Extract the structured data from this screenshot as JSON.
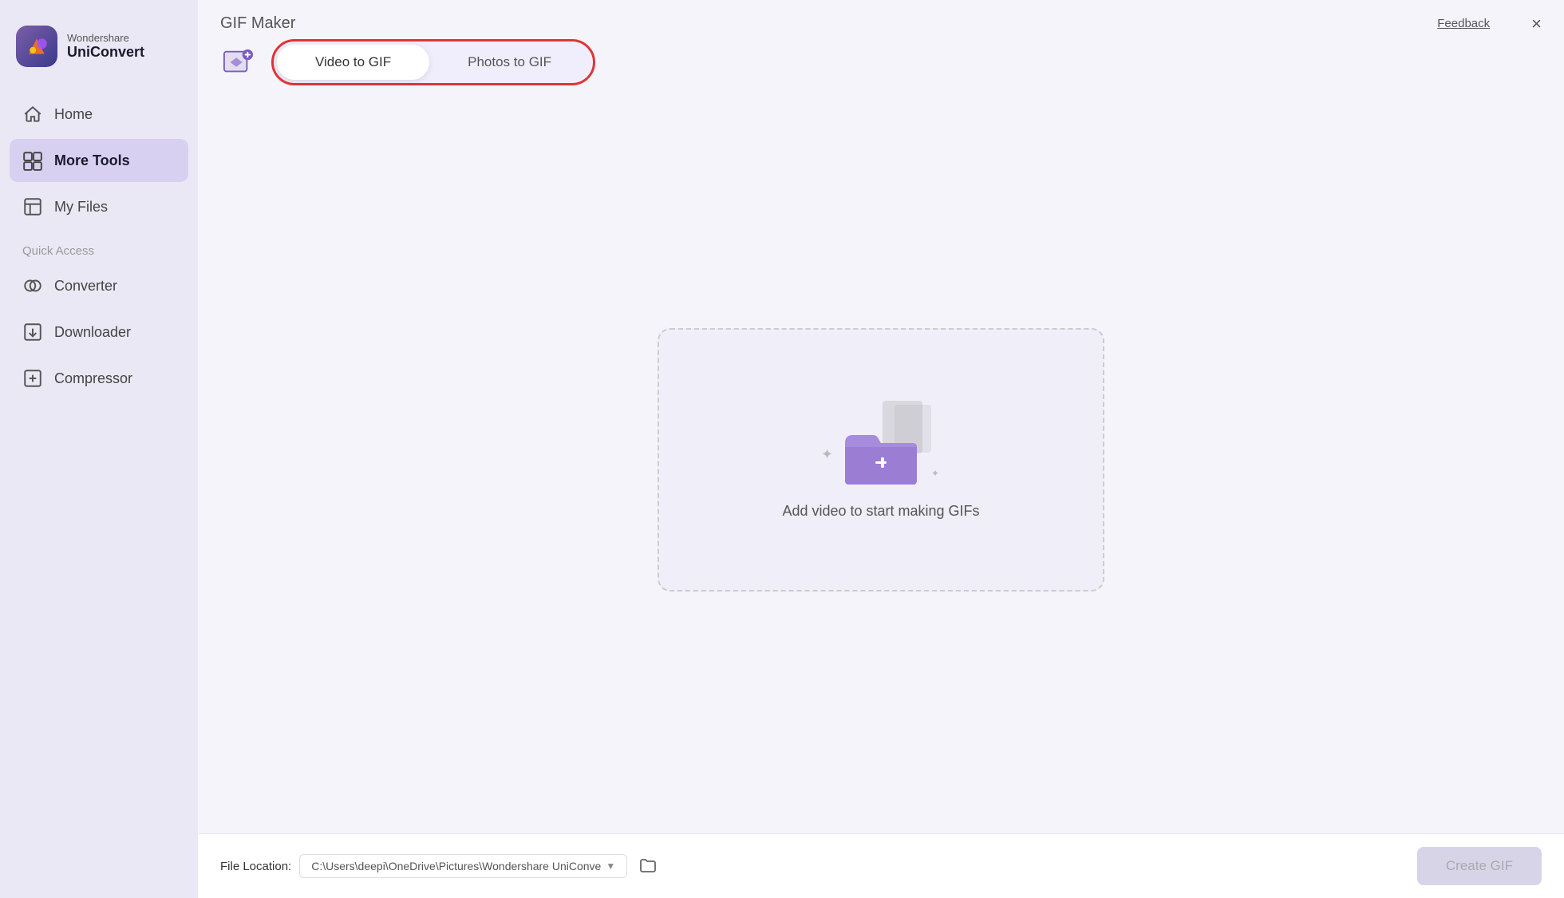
{
  "app": {
    "name": "Wondershare",
    "product": "UniConvert",
    "feedback_label": "Feedback",
    "close_label": "×"
  },
  "sidebar": {
    "nav_items": [
      {
        "id": "home",
        "label": "Home",
        "icon": "home-icon",
        "active": false
      },
      {
        "id": "more-tools",
        "label": "More Tools",
        "icon": "more-tools-icon",
        "active": true
      },
      {
        "id": "my-files",
        "label": "My Files",
        "icon": "my-files-icon",
        "active": false
      }
    ],
    "quick_access_label": "Quick Access",
    "quick_access_items": [
      {
        "id": "converter",
        "label": "Converter",
        "icon": "converter-icon"
      },
      {
        "id": "downloader",
        "label": "Downloader",
        "icon": "downloader-icon"
      },
      {
        "id": "compressor",
        "label": "Compressor",
        "icon": "compressor-icon"
      }
    ]
  },
  "main": {
    "page_title": "GIF Maker",
    "tabs": [
      {
        "id": "video-to-gif",
        "label": "Video to GIF",
        "active": true
      },
      {
        "id": "photos-to-gif",
        "label": "Photos to GIF",
        "active": false
      }
    ],
    "drop_zone": {
      "text": "Add video to start making GIFs"
    },
    "bottom": {
      "file_location_label": "File Location:",
      "file_location_path": "C:\\Users\\deepi\\OneDrive\\Pictures\\Wondershare UniConve",
      "create_gif_label": "Create GIF"
    }
  }
}
